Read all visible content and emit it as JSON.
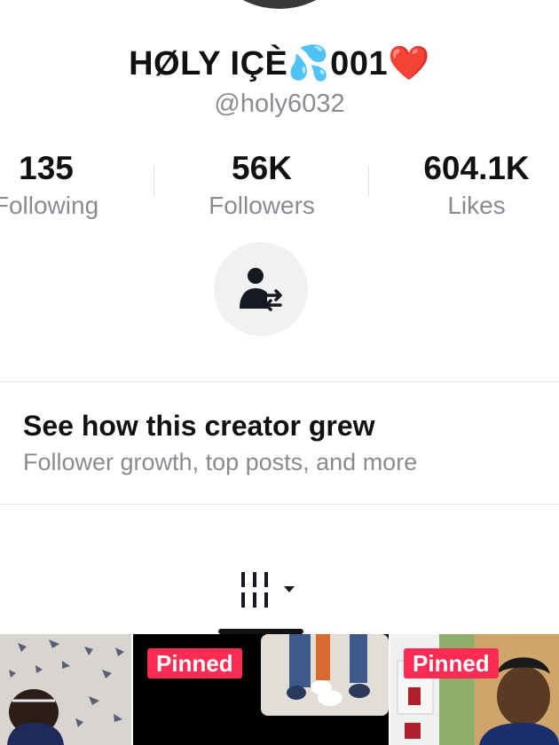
{
  "profile": {
    "name": "HØLY IÇÈ💦001❤️",
    "handle": "@holy6032"
  },
  "stats": {
    "following": {
      "value": "135",
      "label": "Following"
    },
    "followers": {
      "value": "56K",
      "label": "Followers"
    },
    "likes": {
      "value": "604.1K",
      "label": "Likes"
    }
  },
  "actions": {
    "switch_account_icon": "user-switch-icon"
  },
  "creator_insights": {
    "title": "See how this creator grew",
    "subtitle": "Follower growth, top posts, and more"
  },
  "tabs": {
    "grid_icon": "grid-dropdown-icon"
  },
  "videos": [
    {
      "pinned": false
    },
    {
      "pinned": true,
      "badge": "Pinned"
    },
    {
      "pinned": true,
      "badge": "Pinned"
    }
  ],
  "colors": {
    "pinned_badge": "#fe2c55",
    "muted_text": "#8a8b91"
  }
}
